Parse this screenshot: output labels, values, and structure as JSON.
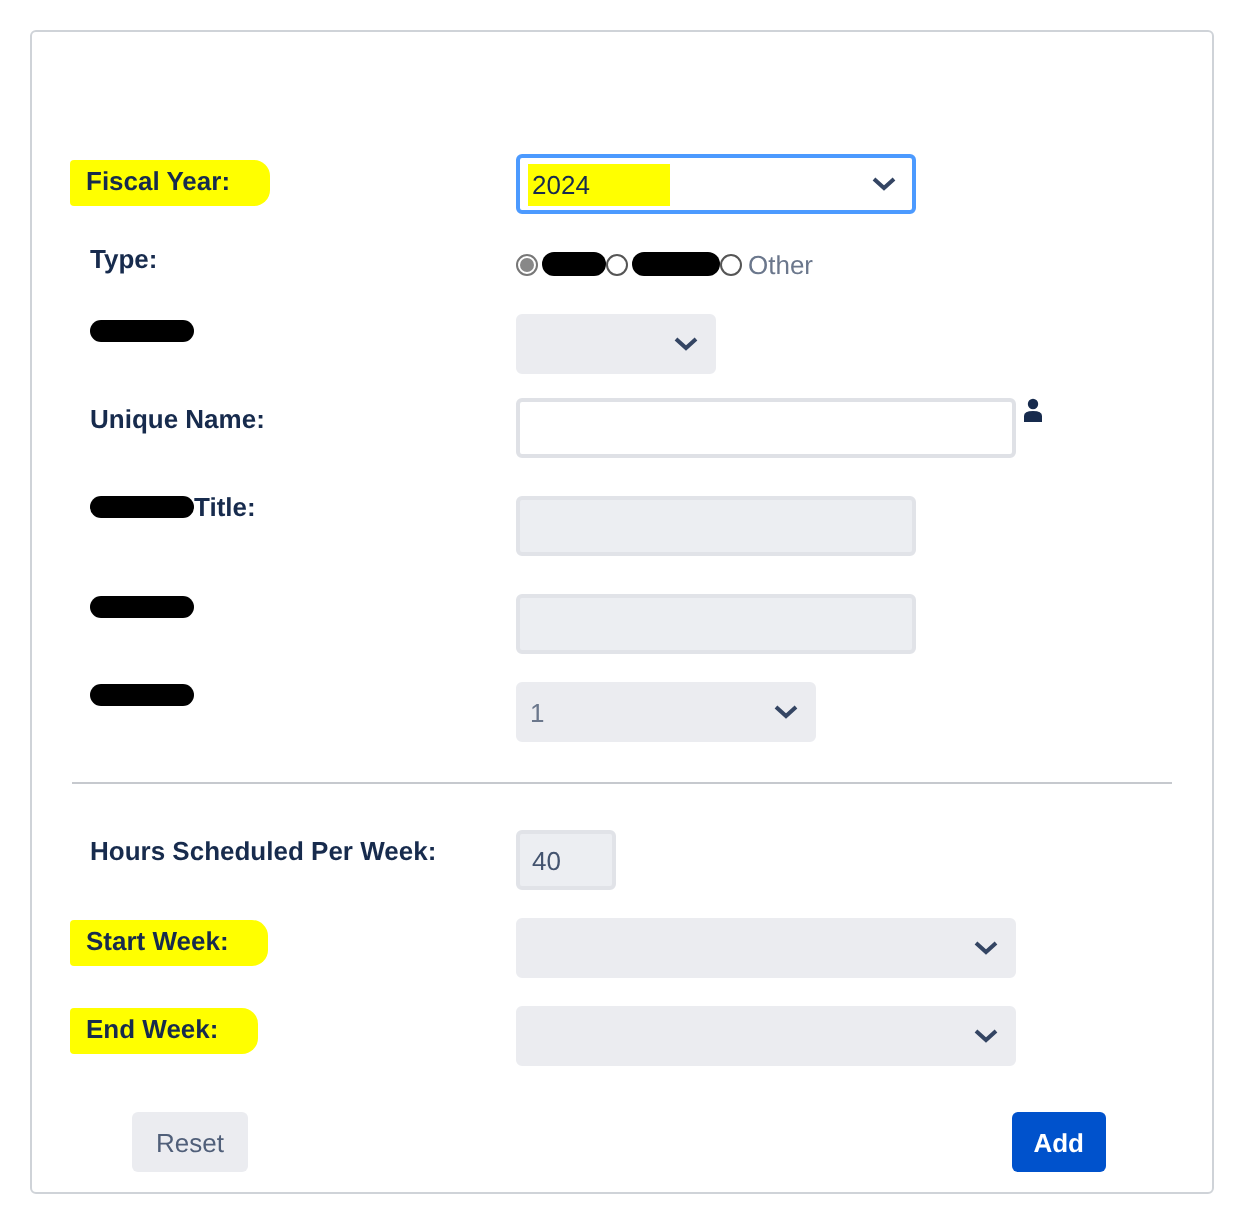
{
  "form_top": [
    {
      "label": "Fiscal Year:",
      "highlighted": true,
      "control": {
        "kind": "select",
        "value": "2024",
        "disabled": false,
        "focused": true,
        "highlighted": true
      }
    },
    {
      "label": "Type:",
      "control": {
        "kind": "radio",
        "options": [
          {
            "redacted": true,
            "selected": true
          },
          {
            "redacted": true,
            "selected": false
          },
          {
            "label": "Other",
            "selected": false
          }
        ]
      }
    },
    {
      "label_redacted": true,
      "control": {
        "kind": "select",
        "disabled": true,
        "focused": false
      }
    },
    {
      "label": "Unique Name:",
      "control": {
        "kind": "text",
        "disabled": false,
        "user_icon": true
      }
    },
    {
      "label": "Title:",
      "label_redacted": true,
      "control": {
        "kind": "text",
        "disabled": true
      }
    },
    {
      "label_redacted": true,
      "control": {
        "kind": "text",
        "disabled": true
      }
    },
    {
      "label_redacted": true,
      "control": {
        "kind": "select",
        "value": "1",
        "disabled": true,
        "focused": false
      }
    }
  ],
  "form_bottom": [
    {
      "label": "Hours Scheduled Per Week:",
      "control": {
        "kind": "text",
        "value": "40",
        "disabled": true
      }
    },
    {
      "label": "Start Week:",
      "highlighted": true,
      "control": {
        "kind": "select",
        "disabled": true,
        "focused": false
      }
    },
    {
      "label": "End Week:",
      "highlighted": true,
      "control": {
        "kind": "select",
        "disabled": true,
        "focused": false
      }
    }
  ],
  "buttons": {
    "reset": "Reset",
    "add": "Add"
  }
}
